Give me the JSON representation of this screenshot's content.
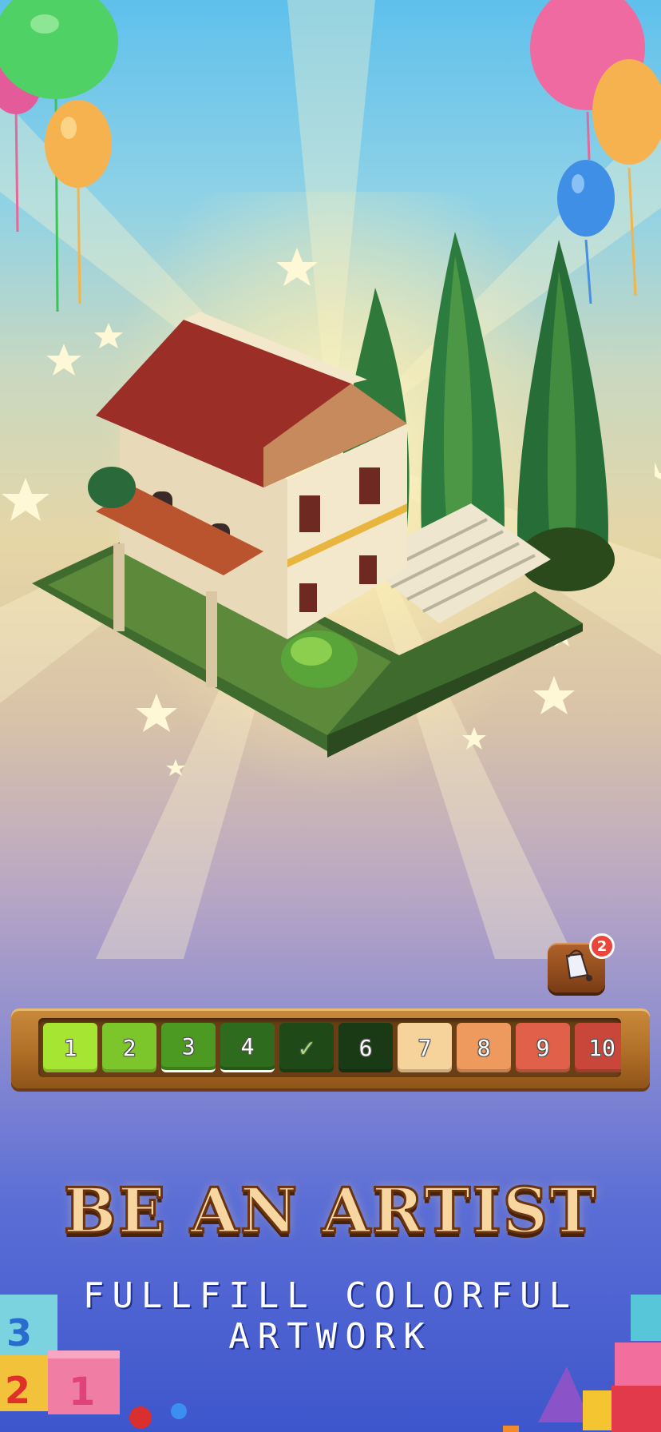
{
  "palette": {
    "swatches": [
      {
        "label": "1",
        "color": "#a6e632",
        "state": "normal"
      },
      {
        "label": "2",
        "color": "#7cc52a",
        "state": "normal"
      },
      {
        "label": "3",
        "color": "#4c9a22",
        "state": "selected"
      },
      {
        "label": "4",
        "color": "#2f6b1e",
        "state": "selected"
      },
      {
        "label": "✓",
        "color": "#1f4a18",
        "state": "done"
      },
      {
        "label": "6",
        "color": "#1a3a16",
        "state": "normal"
      },
      {
        "label": "7",
        "color": "#f7d39c",
        "state": "normal"
      },
      {
        "label": "8",
        "color": "#ee9a5e",
        "state": "normal"
      },
      {
        "label": "9",
        "color": "#e0604a",
        "state": "normal"
      },
      {
        "label": "10",
        "color": "#c8473a",
        "state": "normal"
      }
    ]
  },
  "bucket": {
    "icon": "paint-bucket-icon",
    "badge_count": "2"
  },
  "headline": "BE AN ARTIST",
  "subline": "FULLFILL COLORFUL ARTWORK",
  "accent_colors": {
    "wood": "#b06f27",
    "headline_fill": "#f7d6a0",
    "badge": "#e9473c"
  }
}
